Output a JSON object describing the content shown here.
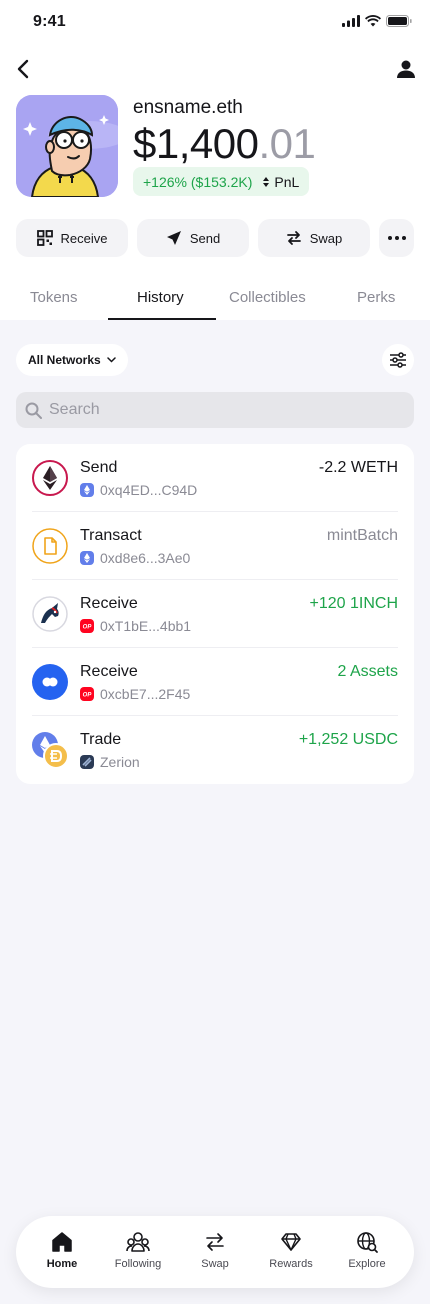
{
  "status_bar": {
    "time": "9:41"
  },
  "profile": {
    "ens_name": "ensname.eth",
    "balance_int": "$1,400",
    "balance_dec": ".01",
    "change": "+126% ($153.2K)",
    "pnl_label": "PnL"
  },
  "actions": [
    {
      "label": "Receive",
      "icon": "qr-code-icon"
    },
    {
      "label": "Send",
      "icon": "send-icon"
    },
    {
      "label": "Swap",
      "icon": "swap-icon"
    },
    {
      "label": "",
      "icon": "more-icon"
    }
  ],
  "tabs": [
    {
      "label": "Tokens",
      "active": false
    },
    {
      "label": "History",
      "active": true
    },
    {
      "label": "Collectibles",
      "active": false
    },
    {
      "label": "Perks",
      "active": false
    }
  ],
  "filter": {
    "network_label": "All Networks"
  },
  "search": {
    "placeholder": "Search",
    "value": ""
  },
  "history": [
    {
      "title": "Send",
      "address": "0xq4ED...C94D",
      "amount": "-2.2 WETH",
      "amount_color": "#16161A",
      "icon": "ethereum-icon",
      "network_icon": "ethereum-network-icon"
    },
    {
      "title": "Transact",
      "address": "0xd8e6...3Ae0",
      "amount": "mintBatch",
      "amount_color": "#8A8A94",
      "icon": "document-icon",
      "network_icon": "ethereum-network-icon"
    },
    {
      "title": "Receive",
      "address": "0xT1bE...4bb1",
      "amount": "+120 1INCH",
      "amount_color": "#1EA44A",
      "icon": "1inch-unicorn-icon",
      "network_icon": "optimism-network-icon"
    },
    {
      "title": "Receive",
      "address": "0xcbE7...2F45",
      "amount": "2 Assets",
      "amount_color": "#1EA44A",
      "icon": "multi-asset-icon",
      "network_icon": "optimism-network-icon"
    },
    {
      "title": "Trade",
      "address": "Zerion",
      "amount": "+1,252 USDC",
      "amount_color": "#1EA44A",
      "icon": "eth-usdc-trade-icon",
      "network_icon": "zerion-icon"
    }
  ],
  "bottom_nav": [
    {
      "label": "Home",
      "active": true,
      "icon": "home-icon"
    },
    {
      "label": "Following",
      "active": false,
      "icon": "people-icon"
    },
    {
      "label": "Swap",
      "active": false,
      "icon": "swap-icon"
    },
    {
      "label": "Rewards",
      "active": false,
      "icon": "diamond-icon"
    },
    {
      "label": "Explore",
      "active": false,
      "icon": "globe-search-icon"
    }
  ],
  "colors": {
    "accent_green": "#1EA44A",
    "background": "#F5F5FA",
    "text": "#16161A",
    "muted": "#8A8A94"
  }
}
